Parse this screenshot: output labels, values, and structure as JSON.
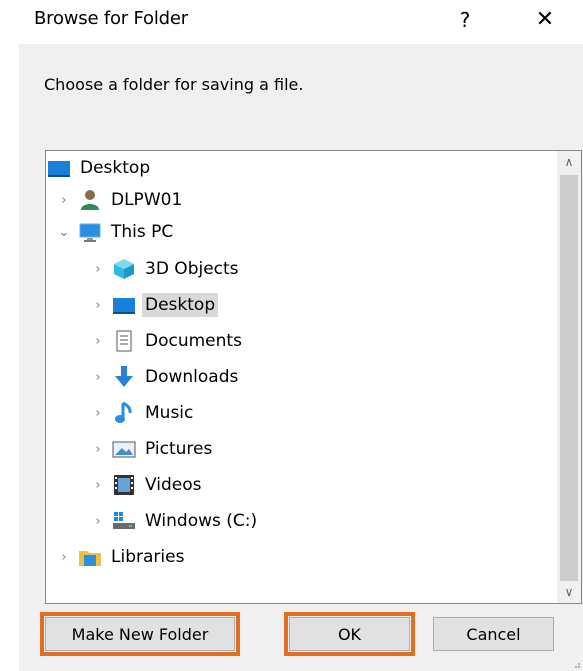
{
  "dialog": {
    "title": "Browse for Folder",
    "help_label": "?",
    "close_label": "✕",
    "instruction": "Choose a folder for saving a file."
  },
  "tree": {
    "items": [
      {
        "label": "Desktop",
        "icon": "desktop-icon",
        "expander": ""
      },
      {
        "label": "DLPW01",
        "icon": "user-icon",
        "expander": "›"
      },
      {
        "label": "This PC",
        "icon": "pc-icon",
        "expander": "⌄"
      },
      {
        "label": "3D Objects",
        "icon": "3d-objects-icon",
        "expander": "›"
      },
      {
        "label": "Desktop",
        "icon": "desktop-icon",
        "expander": "›"
      },
      {
        "label": "Documents",
        "icon": "documents-icon",
        "expander": "›"
      },
      {
        "label": "Downloads",
        "icon": "downloads-icon",
        "expander": "›"
      },
      {
        "label": "Music",
        "icon": "music-icon",
        "expander": "›"
      },
      {
        "label": "Pictures",
        "icon": "pictures-icon",
        "expander": "›"
      },
      {
        "label": "Videos",
        "icon": "videos-icon",
        "expander": "›"
      },
      {
        "label": "Windows (C:)",
        "icon": "drive-icon",
        "expander": "›"
      },
      {
        "label": "Libraries",
        "icon": "libraries-icon",
        "expander": "›"
      }
    ],
    "selected_index": 4,
    "scroll_up": "∧",
    "scroll_down": "∨"
  },
  "buttons": {
    "make_new_folder": "Make New Folder",
    "ok": "OK",
    "cancel": "Cancel"
  },
  "colors": {
    "highlight": "#e07020",
    "selection": "#d9d9d9"
  }
}
